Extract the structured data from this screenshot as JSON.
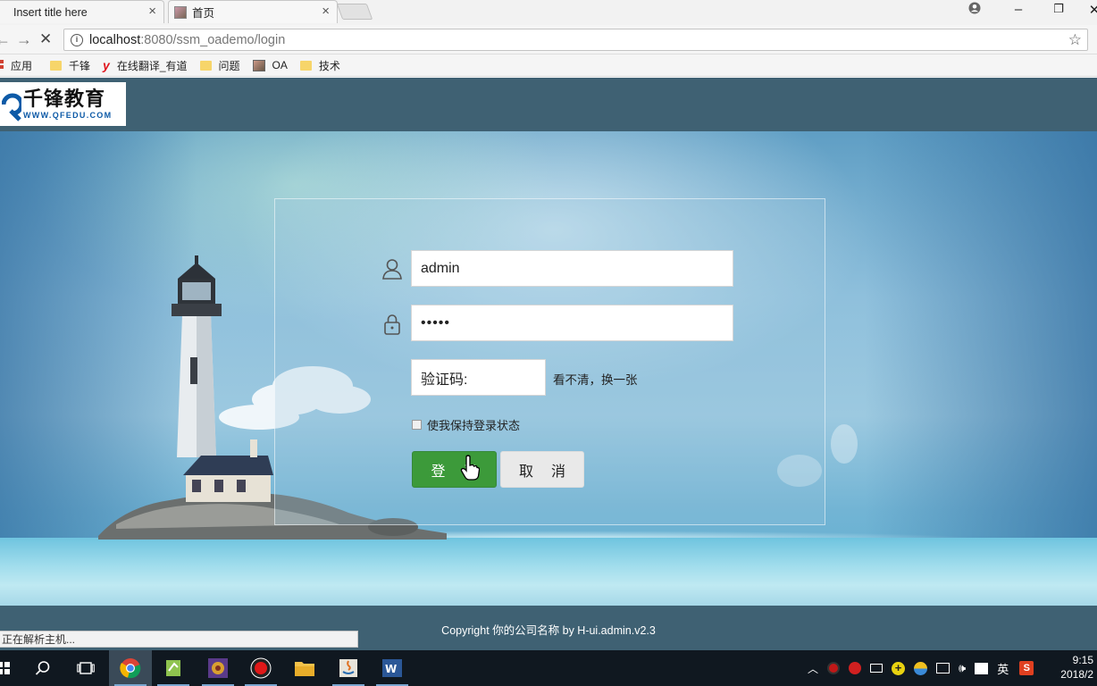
{
  "browser": {
    "tabs": [
      {
        "title": "Insert title here",
        "active": true
      },
      {
        "title": "首页",
        "active": false
      }
    ],
    "url_host": "localhost",
    "url_path": ":8080/ssm_oademo/login",
    "bookmarks": [
      {
        "label": "应用",
        "icon": "apps-icon"
      },
      {
        "label": "千锋",
        "icon": "folder-icon"
      },
      {
        "label": "在线翻译_有道",
        "icon": "youdao-icon"
      },
      {
        "label": "问题",
        "icon": "folder-icon"
      },
      {
        "label": "OA",
        "icon": "image-icon"
      },
      {
        "label": "技术",
        "icon": "folder-icon"
      }
    ]
  },
  "header": {
    "logo_cn": "千锋教育",
    "logo_en": "WWW.QFEDU.COM"
  },
  "login": {
    "username_value": "admin",
    "password_mask": "•••••",
    "captcha_placeholder": "验证码:",
    "captcha_refresh": "看不清，换一张",
    "remember_label": "使我保持登录状态",
    "login_button": "登录",
    "cancel_button": "取消"
  },
  "footer": {
    "copyright": "Copyright 你的公司名称 by H-ui.admin.v2.3"
  },
  "status_bar": {
    "text": "正在解析主机..."
  },
  "taskbar": {
    "tray_ime": "英",
    "time": "9:15",
    "date": "2018/2"
  },
  "colors": {
    "header_bg": "#3f6173",
    "login_button": "#3c9a3a",
    "cancel_button": "#e9e9e9"
  }
}
